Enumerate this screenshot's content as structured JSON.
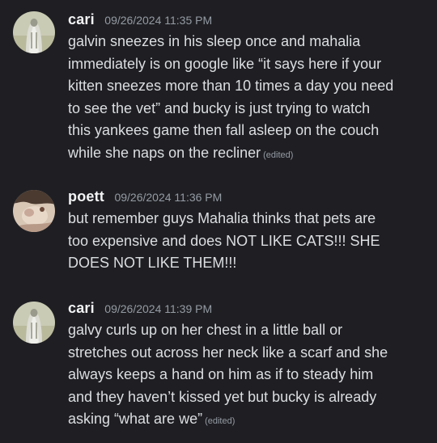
{
  "messages": [
    {
      "username": "cari",
      "timestamp": "09/26/2024 11:35 PM",
      "lines": [
        "galvin sneezes in his sleep once and mahalia",
        "immediately is on google like “it says here if your",
        "kitten sneezes more than 10 times a day you need",
        "to see the vet” and bucky is just trying to watch",
        "this yankees game then fall asleep on the couch",
        "while she naps on the recliner"
      ],
      "edited": "(edited)"
    },
    {
      "username": "poett",
      "timestamp": "09/26/2024 11:36 PM",
      "lines": [
        "but remember guys Mahalia thinks that pets are",
        "too expensive and does NOT LIKE CATS!!! SHE",
        "DOES NOT LIKE THEM!!!"
      ]
    },
    {
      "username": "cari",
      "timestamp": "09/26/2024 11:39 PM",
      "lines": [
        "galvy curls up on her chest in a little ball or",
        "stretches out across her neck like a scarf and she",
        "always keeps a hand on him as if to steady him",
        "and they haven’t kissed yet but bucky is already",
        "asking “what are we”"
      ],
      "edited": "(edited)"
    }
  ],
  "colors": {
    "background": "#1f1f23",
    "username": "#f2f3f5",
    "timestamp": "#949ba4",
    "text": "#dbdee1"
  }
}
